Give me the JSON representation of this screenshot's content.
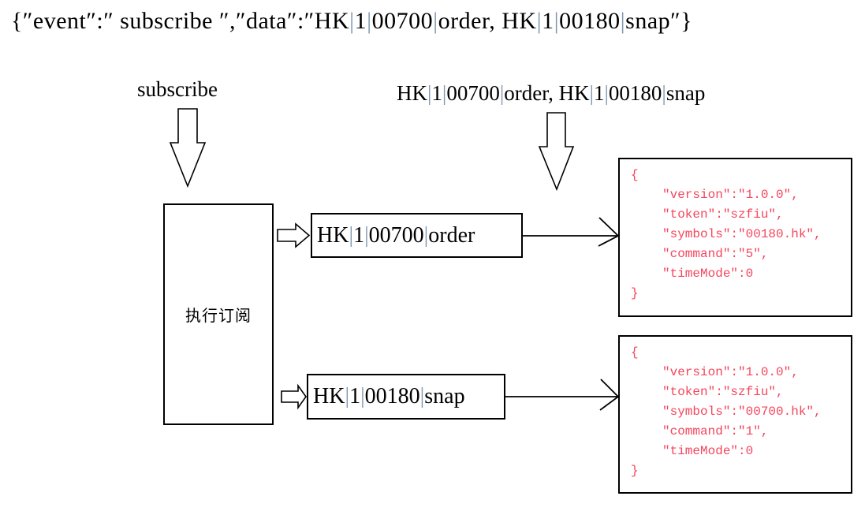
{
  "top_message": {
    "prefix": "{″event″:″ subscribe ″,″data″:″",
    "segments": [
      "HK",
      "1",
      "00700",
      "order, HK",
      "1",
      "00180",
      "snap"
    ],
    "suffix": "″}"
  },
  "annotations": {
    "event_label": "subscribe",
    "data_label_segments": [
      "HK",
      "1",
      "00700",
      "order, HK",
      "1",
      "00180",
      "snap"
    ]
  },
  "process": {
    "label": "执行订阅"
  },
  "topics": [
    {
      "name": "topic-order",
      "segments": [
        "HK",
        "1",
        "00700",
        "order"
      ]
    },
    {
      "name": "topic-snap",
      "segments": [
        "HK",
        "1",
        "00180",
        "snap"
      ]
    }
  ],
  "payloads": [
    {
      "open_brace": "{",
      "lines": [
        "″version″:″1.0.0″,",
        "″token″:″szfiu″,",
        "″symbols″:″00180.hk″,",
        "″command″:″5″,",
        "″timeMode″:0"
      ],
      "close_brace": "}"
    },
    {
      "open_brace": "{",
      "lines": [
        "″version″:″1.0.0″,",
        "″token″:″szfiu″,",
        "″symbols″:″00700.hk″,",
        "″command″:″1″,",
        "″timeMode″:0"
      ],
      "close_brace": "}"
    }
  ],
  "colors": {
    "payload_text": "#f5455c",
    "stroke": "#000000",
    "pipe": "#7f96b0",
    "background": "#ffffff"
  },
  "separator": "|"
}
